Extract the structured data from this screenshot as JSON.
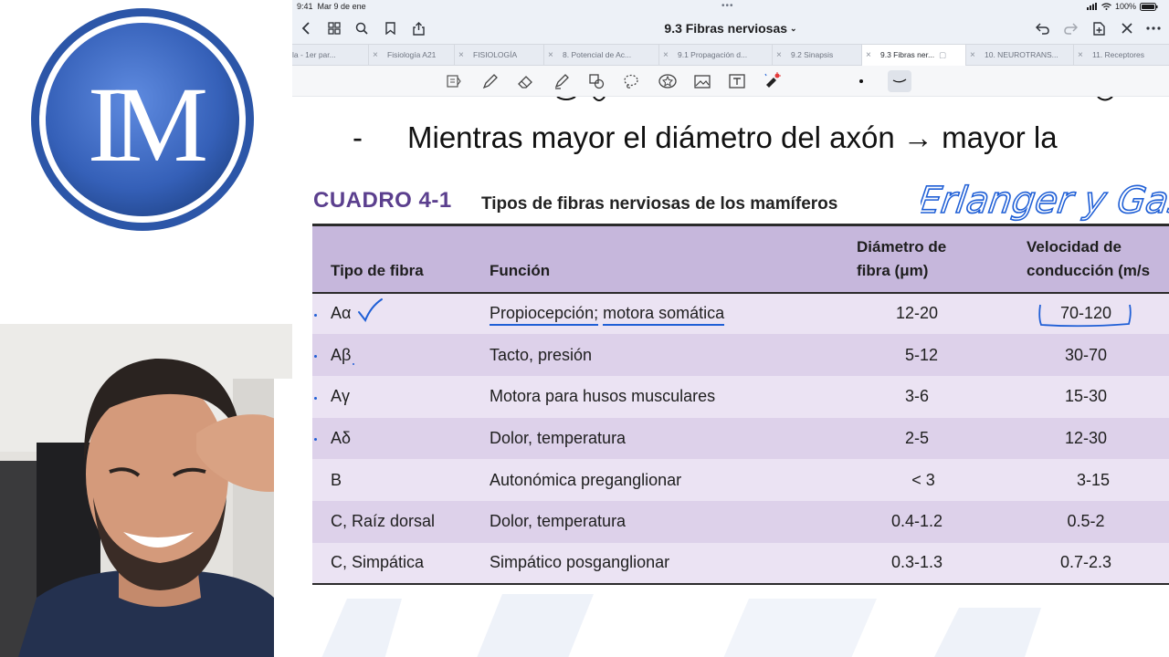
{
  "status_bar": {
    "time": "9:41",
    "date": "Mar 9 de ene",
    "battery": "100%"
  },
  "nav": {
    "title": "9.3 Fibras nerviosas",
    "icons": [
      "back-chevron-icon",
      "grid-icon",
      "search-icon",
      "bookmark-icon",
      "share-icon",
      "undo-icon",
      "redo-icon",
      "add-page-icon",
      "close-icon",
      "more-icon"
    ]
  },
  "tabs": [
    {
      "label": "la - 1er par...",
      "active": false
    },
    {
      "label": "Fisiología A21",
      "active": false
    },
    {
      "label": "FISIOLOGÍA",
      "active": false
    },
    {
      "label": "8. Potencial de Ac...",
      "active": false
    },
    {
      "label": "9.1 Propagación d...",
      "active": false
    },
    {
      "label": "9.2 Sinapsis",
      "active": false
    },
    {
      "label": "9.3 Fibras ner...",
      "active": true
    },
    {
      "label": "10. NEUROTRANS...",
      "active": false
    },
    {
      "label": "11. Receptores",
      "active": false
    }
  ],
  "toolbar": {
    "tools": [
      "read-mode-icon",
      "pen-icon",
      "eraser-icon",
      "highlighter-icon",
      "shapes-icon",
      "lasso-icon",
      "sticker-icon",
      "image-icon",
      "text-icon",
      "laser-pointer-icon"
    ],
    "colors": [
      "#111111"
    ]
  },
  "logo": {
    "text": "IM",
    "colors": {
      "ring": "#2f5fb4",
      "inner": "#3e6cc4"
    }
  },
  "document": {
    "bullet_dash": "-",
    "bullet_text": "Mientras mayor el diámetro del axón → mayor la",
    "cuadro_label": "CUADRO 4-1",
    "cuadro_title": "Tipos de fibras nerviosas de los mamíferos",
    "handwritten_note": "Erlanger y Gas",
    "table": {
      "headers": [
        "Tipo de fibra",
        "Función",
        "Diámetro de fibra (μm)",
        "Velocidad de conducción (m/s)"
      ],
      "header_lines": {
        "col3_line1": "Diámetro de",
        "col3_line2": "fibra (μm)",
        "col4_line1": "Velocidad de",
        "col4_line2": "conducción (m/s"
      },
      "rows": [
        {
          "tipo": "Aα",
          "funcion_a": "Propiocepción;",
          "funcion_b": "motora somática",
          "diametro": "12-20",
          "velocidad": "70-120"
        },
        {
          "tipo": "Aβ",
          "funcion": "Tacto, presión",
          "diametro": "5-12",
          "velocidad": "30-70"
        },
        {
          "tipo": "Aγ",
          "funcion": "Motora para husos musculares",
          "diametro": "3-6",
          "velocidad": "15-30"
        },
        {
          "tipo": "Aδ",
          "funcion": "Dolor, temperatura",
          "diametro": "2-5",
          "velocidad": "12-30"
        },
        {
          "tipo": "B",
          "funcion": "Autonómica preganglionar",
          "diametro": "< 3",
          "velocidad": "3-15"
        },
        {
          "tipo": "C, Raíz dorsal",
          "funcion": "Dolor, temperatura",
          "diametro": "0.4-1.2",
          "velocidad": "0.5-2"
        },
        {
          "tipo": "C, Simpática",
          "funcion": "Simpático posganglionar",
          "diametro": "0.3-1.3",
          "velocidad": "0.7-2.3"
        }
      ]
    }
  },
  "ink_color": "#1f5fd6",
  "accent_purple": "#5b3f8e"
}
